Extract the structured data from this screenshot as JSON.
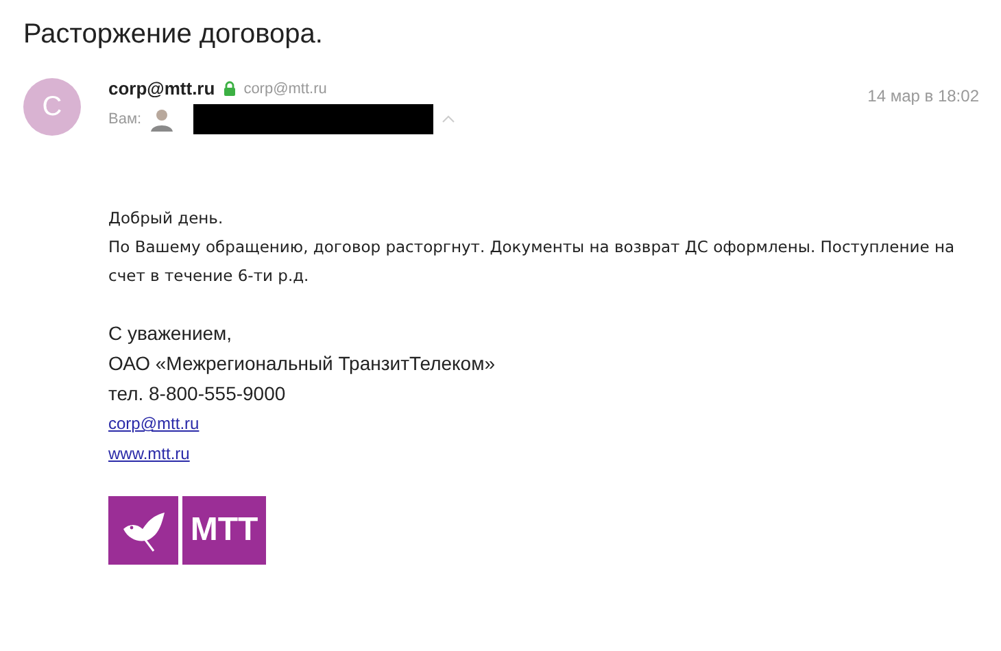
{
  "subject": "Расторжение договора.",
  "sender": {
    "avatar_letter": "C",
    "name": "corp@mtt.ru",
    "verified_address": "corp@mtt.ru",
    "to_label": "Вам:",
    "date": "14 мар в 18:02"
  },
  "body": {
    "paragraphs": [
      [
        "Добрый день.",
        "По Вашему обращению, договор расторгнут. Документы на возврат ДС оформлены. Поступление на счет в течение 6-ти р.д."
      ]
    ],
    "signature": [
      "С уважением,",
      "ОАО «Межрегиональный ТранзитТелеком»",
      "тел. 8-800-555-9000"
    ],
    "links": [
      "corp@mtt.ru",
      "www.mtt.ru"
    ],
    "logo_text": "МТТ"
  }
}
